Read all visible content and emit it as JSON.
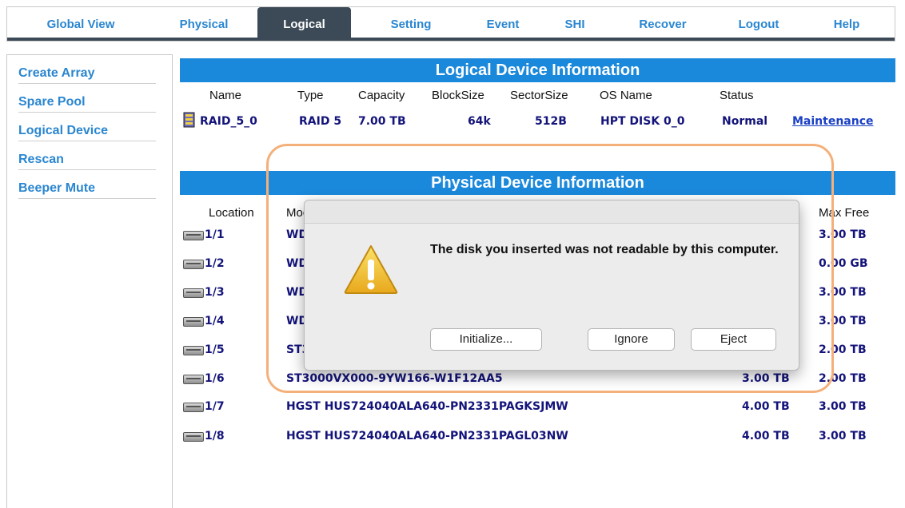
{
  "nav": {
    "tabs": [
      {
        "label": "Global View"
      },
      {
        "label": "Physical"
      },
      {
        "label": "Logical"
      },
      {
        "label": "Setting"
      },
      {
        "label": "Event"
      },
      {
        "label": "SHI"
      },
      {
        "label": "Recover"
      },
      {
        "label": "Logout"
      },
      {
        "label": "Help"
      }
    ],
    "active": "Logical"
  },
  "sidebar": {
    "items": [
      {
        "label": "Create Array"
      },
      {
        "label": "Spare Pool"
      },
      {
        "label": "Logical Device"
      },
      {
        "label": "Rescan"
      },
      {
        "label": "Beeper Mute"
      }
    ]
  },
  "logical": {
    "title": "Logical Device Information",
    "headers": {
      "name": "Name",
      "type": "Type",
      "capacity": "Capacity",
      "blocksize": "BlockSize",
      "sectorsize": "SectorSize",
      "osname": "OS Name",
      "status": "Status"
    },
    "row": {
      "name": "RAID_5_0",
      "type": "RAID 5",
      "capacity": "7.00 TB",
      "blocksize": "64k",
      "sectorsize": "512B",
      "osname": "HPT DISK 0_0",
      "status": "Normal",
      "action": "Maintenance"
    }
  },
  "physical": {
    "title": "Physical Device Information",
    "headers": {
      "location": "Location",
      "model": "Mod",
      "maxfree": "Max Free"
    },
    "rows": [
      {
        "location": "1/1",
        "model": "WD(",
        "capacity": "",
        "maxfree": "3.00 TB"
      },
      {
        "location": "1/2",
        "model": "WD(",
        "capacity": "",
        "maxfree": "0.00 GB"
      },
      {
        "location": "1/3",
        "model": "WD(",
        "capacity": "",
        "maxfree": "3.00 TB"
      },
      {
        "location": "1/4",
        "model": "WD(",
        "capacity": "",
        "maxfree": "3.00 TB"
      },
      {
        "location": "1/5",
        "model": "ST3",
        "capacity": "",
        "maxfree": "2.00 TB"
      },
      {
        "location": "1/6",
        "model": "ST3000VX000-9YW166-W1F12AA5",
        "capacity": "3.00 TB",
        "maxfree": "2.00 TB"
      },
      {
        "location": "1/7",
        "model": "HGST HUS724040ALA640-PN2331PAGKSJMW",
        "capacity": "4.00 TB",
        "maxfree": "3.00 TB"
      },
      {
        "location": "1/8",
        "model": "HGST HUS724040ALA640-PN2331PAGL03NW",
        "capacity": "4.00 TB",
        "maxfree": "3.00 TB"
      }
    ]
  },
  "dialog": {
    "message": "The disk you inserted was not readable by this computer.",
    "buttons": {
      "initialize": "Initialize...",
      "ignore": "Ignore",
      "eject": "Eject"
    },
    "icon": "warning-icon"
  },
  "colors": {
    "accent": "#1a88db",
    "nav_active": "#3c4a58",
    "link": "#2a86d0",
    "highlight": "#f4b07a"
  }
}
